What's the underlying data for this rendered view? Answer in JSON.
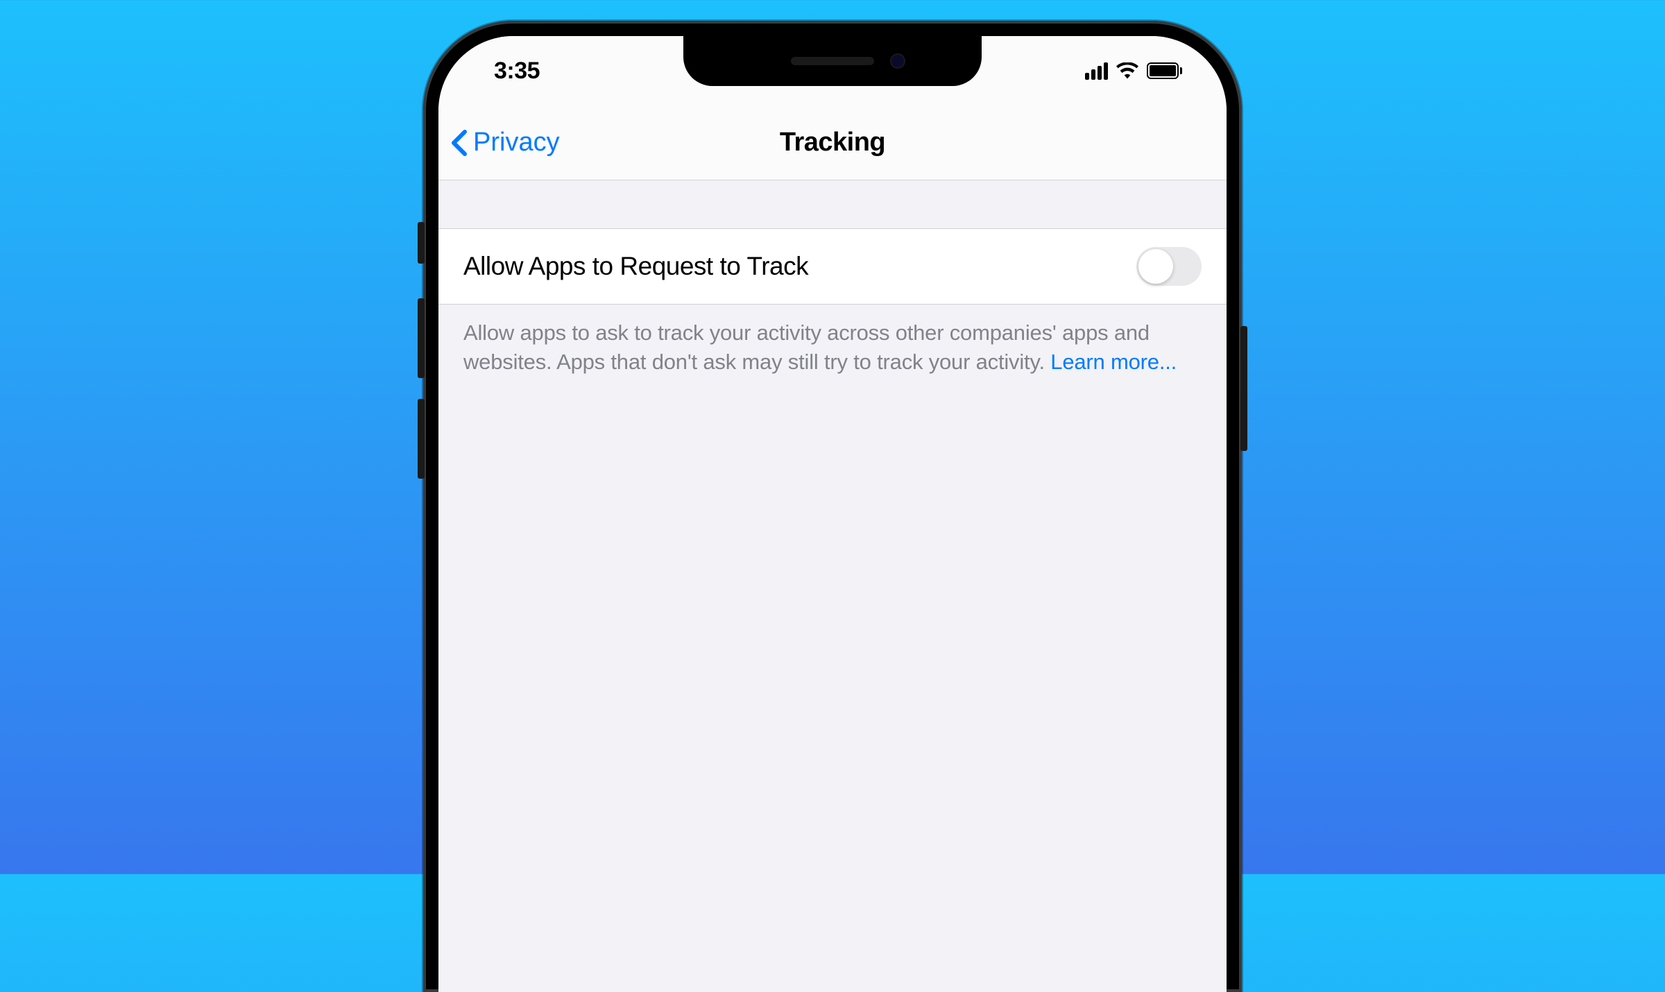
{
  "status_bar": {
    "time": "3:35"
  },
  "nav": {
    "back_label": "Privacy",
    "title": "Tracking"
  },
  "setting": {
    "label": "Allow Apps to Request to Track",
    "enabled": false
  },
  "footer": {
    "description": "Allow apps to ask to track your activity across other companies' apps and websites. Apps that don't ask may still try to track your activity. ",
    "learn_more": "Learn more..."
  }
}
